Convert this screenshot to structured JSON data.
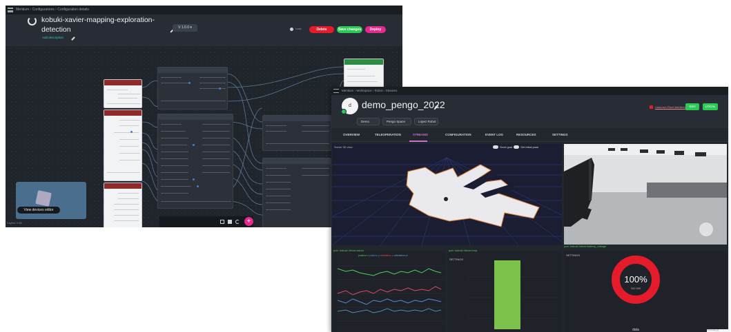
{
  "config_editor": {
    "breadcrumbs": "Mentium  ›  Configurations  ›  Configuration details",
    "title": "kobuki-xavier-mapping-exploration-detection",
    "subtitle": "Add description",
    "version": "V 1.0.0 ▾",
    "lock_label": "Lock",
    "buttons": {
      "delete": "Delete",
      "save": "Save changes",
      "deploy": "Deploy"
    },
    "view_devices": "View devices editor",
    "footer": "Layers: 0.62",
    "colors": {
      "delete": "#e31b2a",
      "save": "#2dc955",
      "deploy": "#e62a8b"
    }
  },
  "robot_dashboard": {
    "breadcrumbs": "Mentium  ›  Workspace  ›  Robot  ›  Streams",
    "robot_name": "demo_pengo_2022",
    "avatar_letter": "d",
    "chips": [
      "Demo",
      "Pengo Space",
      "Lopez Robot"
    ],
    "warning_link": "Unknown Fleet Interference",
    "buttons": [
      "SSH",
      "LOCAL"
    ],
    "tabs": [
      "OVERVIEW",
      "TELEOPERATION",
      "STREAMS",
      "CONFIGURATION",
      "EVENT LOG",
      "RESOURCES",
      "SETTINGS"
    ],
    "active_tab": "STREAMS",
    "scene_label": "Scene 3D view",
    "scene_controls": [
      "Send goal",
      "Set initial pose"
    ],
    "camera_label": "pub: kobuki /driver/battery_voltage",
    "line_label": "pub: kobuki /driver/odom",
    "bar_label": "pub: kobuki /driver/cmp",
    "line_legend": [
      "position.x",
      "position.y",
      "orientation.z",
      "orientation.w"
    ],
    "settings_label": "SETTINGS",
    "gauge": {
      "value": "100%",
      "sub": "102.000",
      "caption": "data"
    },
    "corner_note": "Thumbnails.jpg"
  }
}
